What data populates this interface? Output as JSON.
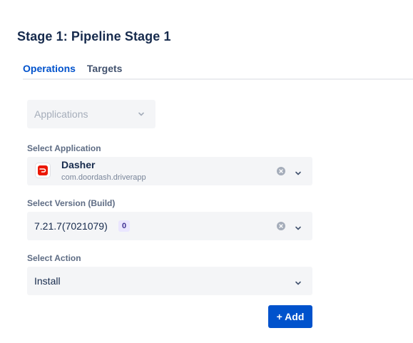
{
  "stage": {
    "title": "Stage 1: Pipeline Stage 1"
  },
  "tabs": [
    {
      "label": "Operations",
      "active": true
    },
    {
      "label": "Targets",
      "active": false
    }
  ],
  "operation_select": {
    "placeholder": "Applications"
  },
  "application": {
    "label": "Select Application",
    "name": "Dasher",
    "package": "com.doordash.driverapp",
    "icon": "doordash-app-icon",
    "icon_color": "#eb1700"
  },
  "version": {
    "label": "Select Version (Build)",
    "value": "7.21.7(7021079)",
    "badge": "0"
  },
  "action": {
    "label": "Select Action",
    "value": "Install"
  },
  "add_button": {
    "label": "+ Add"
  },
  "colors": {
    "accent": "#0052cc",
    "field_bg": "#f4f5f7",
    "badge_bg": "#eae6ff",
    "badge_fg": "#403294"
  }
}
